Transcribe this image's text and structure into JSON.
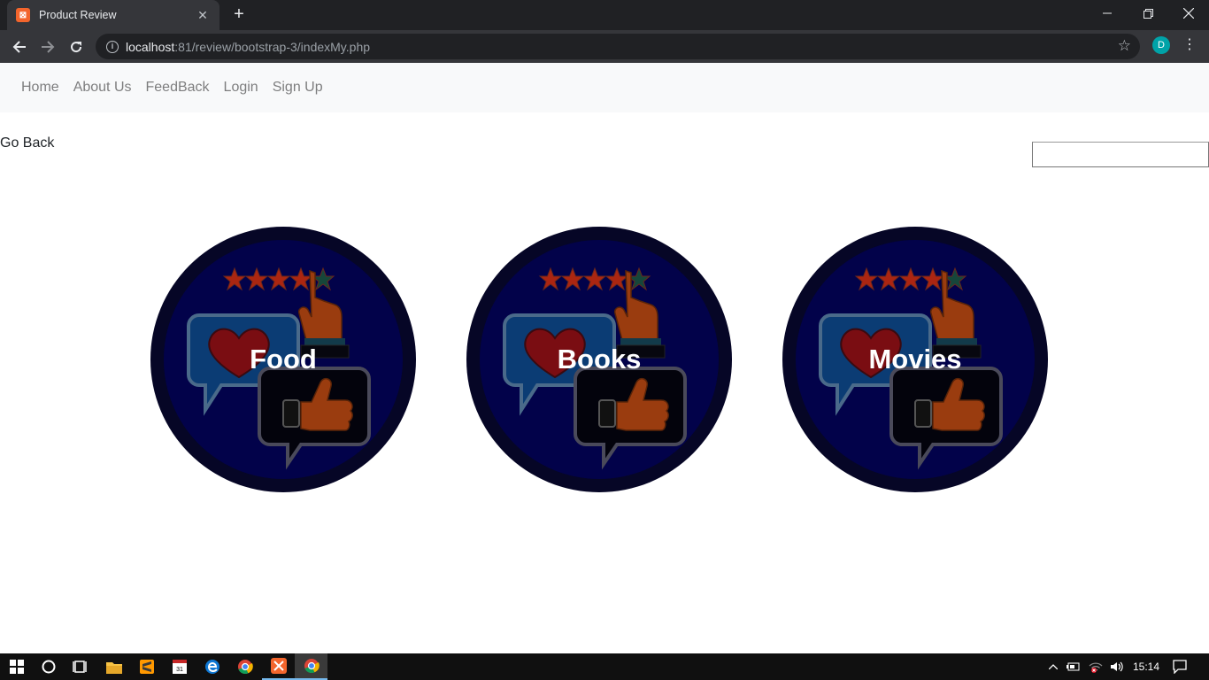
{
  "browser": {
    "tab_title": "Product Review",
    "new_tab": "+",
    "url_host": "localhost",
    "url_rest": ":81/review/bootstrap-3/indexMy.php",
    "profile_initial": "D"
  },
  "navbar": {
    "links": [
      "Home",
      "About Us",
      "FeedBack",
      "Login",
      "Sign Up"
    ]
  },
  "page": {
    "go_back": "Go Back",
    "search_value": ""
  },
  "categories": [
    {
      "label": "Food"
    },
    {
      "label": "Books"
    },
    {
      "label": "Movies"
    }
  ],
  "taskbar": {
    "time": "15:14"
  },
  "colors": {
    "tab_favicon": "#f3652c",
    "avatar": "#00a3a8",
    "circle_bg": "#060626"
  }
}
